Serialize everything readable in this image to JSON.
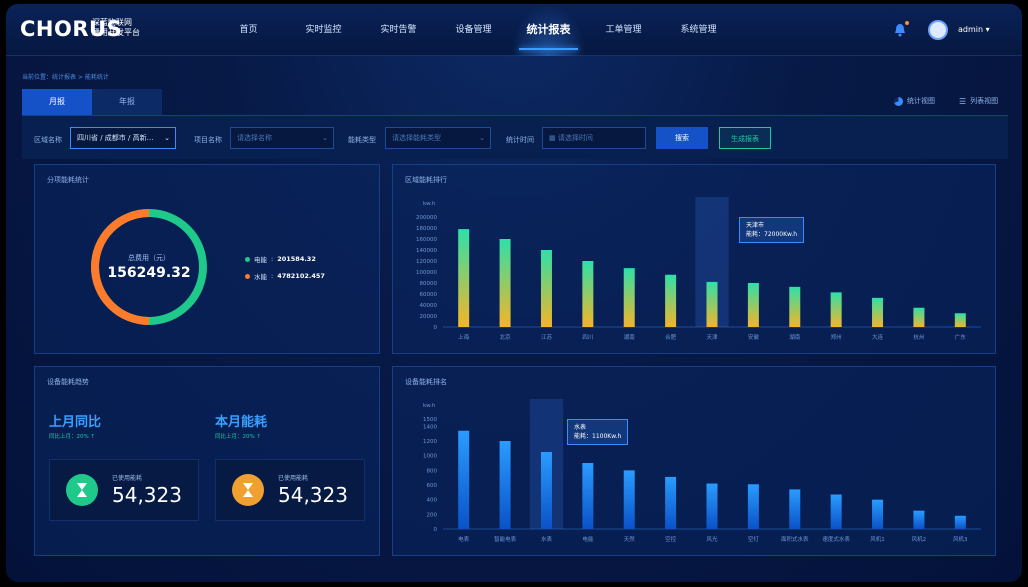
{
  "header": {
    "logo": "CHORUS",
    "logo_sub1": "深蓝物联网",
    "logo_sub2": "通用开发平台",
    "nav": [
      "首页",
      "实时监控",
      "实时告警",
      "设备管理",
      "统计报表",
      "工单管理",
      "系统管理"
    ],
    "active_nav": "统计报表",
    "user": "admin"
  },
  "breadcrumb": "当前位置：统计报表 > 能耗统计",
  "tabs": [
    "月报",
    "年报"
  ],
  "view_buttons": [
    "统计视图",
    "列表视图"
  ],
  "filters": {
    "area_label": "区域名称",
    "area_value": "四川省 / 成都市 / 高新…",
    "project_label": "项目名称",
    "project_placeholder": "请选择名称",
    "energy_label": "能耗类型",
    "energy_placeholder": "请选择能耗类型",
    "time_label": "统计时间",
    "time_placeholder": "请选择时间",
    "query_button": "搜索",
    "report_button": "生成报表"
  },
  "subitem": {
    "title": "分项能耗统计",
    "total_label": "总费用（元）",
    "total_value": "156249.32",
    "legend": [
      {
        "name": "电能",
        "value": "201584.32",
        "color": "#1ec98a"
      },
      {
        "name": "水能",
        "value": "4782102.457",
        "color": "#ff7a2a"
      }
    ]
  },
  "trend": {
    "title": "设备能耗趋势",
    "left_title": "上月同比",
    "left_note": "同比上月：20% ↑",
    "right_title": "本月能耗",
    "right_note": "同比上月：20% ↑",
    "cards": [
      {
        "label": "已使用能耗",
        "value": "54,323",
        "color": "#1ec98a"
      },
      {
        "label": "已使用能耗",
        "value": "54,323",
        "color": "#f0a030"
      }
    ]
  },
  "region_chart": {
    "title": "区域能耗排行",
    "tooltip_title": "天津市",
    "tooltip_value": "能耗：72000Kw.h",
    "tooltip_index": 6
  },
  "device_chart": {
    "title": "设备能耗排名",
    "tooltip_title": "水表",
    "tooltip_value": "能耗：1100Kw.h",
    "tooltip_index": 2
  },
  "chart_data": [
    {
      "type": "bar",
      "title": "区域能耗排行",
      "ylabel": "kw.h",
      "ylim": [
        0,
        200000
      ],
      "yticks": [
        "0",
        "20000",
        "40000",
        "60000",
        "80000",
        "100000",
        "120000",
        "140000",
        "160000",
        "180000",
        "200000"
      ],
      "categories": [
        "上海",
        "北京",
        "江苏",
        "四川",
        "湖南",
        "合肥",
        "天津",
        "安徽",
        "湖南",
        "郑州",
        "大连",
        "杭州",
        "广东"
      ],
      "values": [
        178000,
        160000,
        140000,
        120000,
        107000,
        95000,
        82000,
        80000,
        73000,
        63000,
        53000,
        35000,
        25000
      ],
      "grid": false
    },
    {
      "type": "bar",
      "title": "设备能耗排名",
      "ylabel": "kw.h",
      "ylim": [
        0,
        1500
      ],
      "yticks": [
        "0",
        "200",
        "400",
        "600",
        "800",
        "1000",
        "1200",
        "1400",
        "1500"
      ],
      "categories": [
        "电表",
        "智能电表",
        "水表",
        "电能",
        "天然",
        "空控",
        "风光",
        "空灯",
        "面积式水表",
        "速度式水表",
        "风机1",
        "风机2",
        "风机3"
      ],
      "values": [
        1340,
        1200,
        1050,
        900,
        800,
        710,
        620,
        610,
        540,
        470,
        400,
        250,
        180
      ],
      "grid": false
    }
  ]
}
